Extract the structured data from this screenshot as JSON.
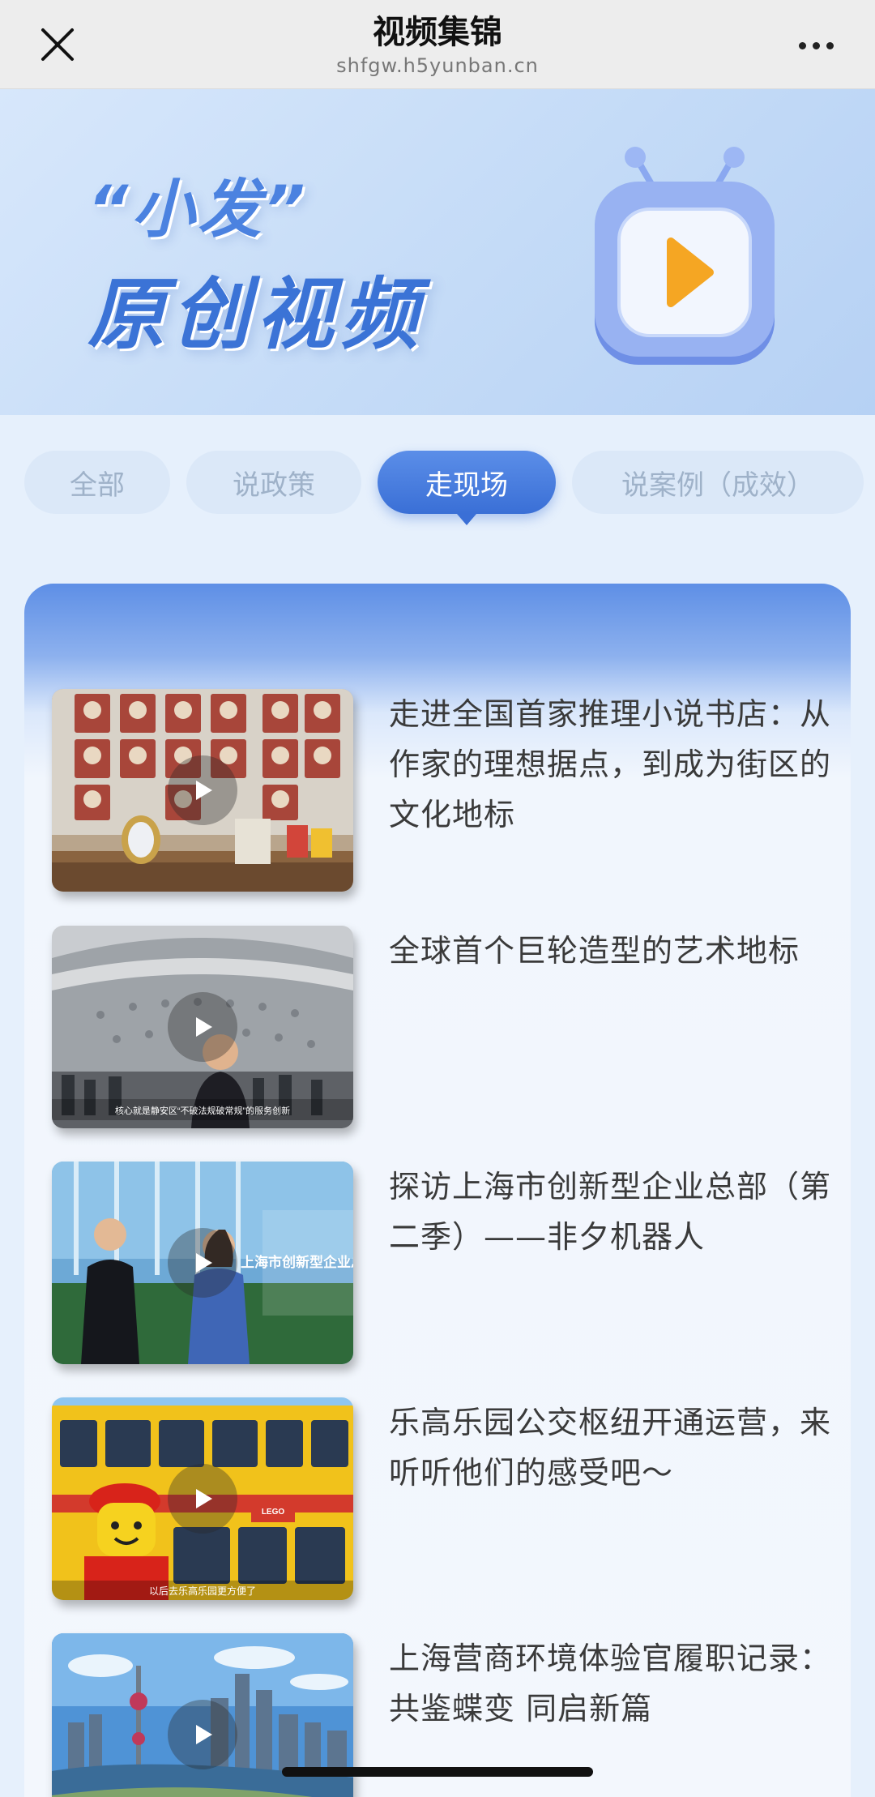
{
  "header": {
    "title": "视频集锦",
    "url": "shfgw.h5yunban.cn"
  },
  "hero": {
    "subtitle": "“小发”",
    "title": "原创视频"
  },
  "tabs": [
    {
      "label": "全部",
      "active": false
    },
    {
      "label": "说政策",
      "active": false
    },
    {
      "label": "走现场",
      "active": true
    },
    {
      "label": "说案例（成效）",
      "active": false
    }
  ],
  "videos": [
    {
      "title": "走进全国首家推理小说书店：从作家的理想据点，到成为街区的文化地标",
      "thumb_overlay": ""
    },
    {
      "title": "全球首个巨轮造型的艺术地标",
      "thumb_overlay": "核心就是静安区“不破法规破常规”的服务创新"
    },
    {
      "title": "探访上海市创新型企业总部（第二季）——非夕机器人",
      "thumb_overlay": "上海市创新型企业总部"
    },
    {
      "title": "乐高乐园公交枢纽开通运营，来听听他们的感受吧～",
      "thumb_overlay": "以后去乐高乐园更方便了"
    },
    {
      "title": "上海营商环境体验官履职记录：共鉴蝶变 同启新篇",
      "thumb_overlay": ""
    }
  ],
  "colors": {
    "accent": "#3a6fd6",
    "tab_inactive_bg": "#dbe8f8",
    "tab_inactive_text": "#9fb2c9",
    "play_icon": "#f5a623"
  }
}
